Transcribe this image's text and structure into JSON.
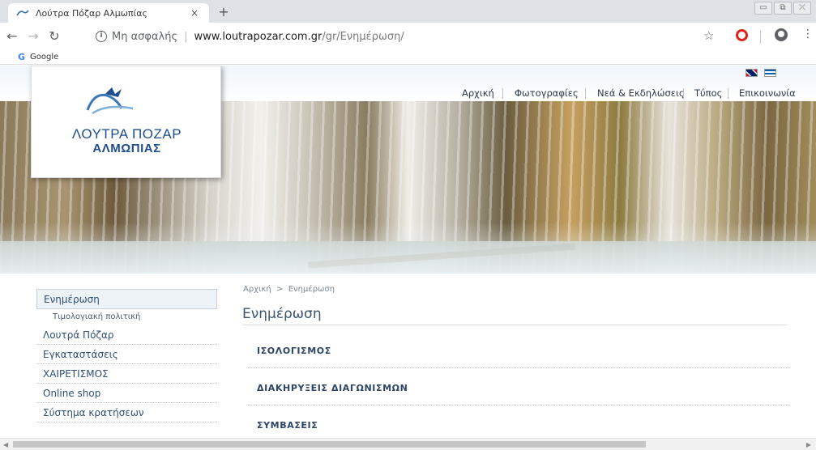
{
  "browser": {
    "tab_title": "Λούτρα Πόζαρ Αλμωπίας",
    "tab_close": "×",
    "new_tab": "+",
    "window_controls": [
      "▭",
      "⧉",
      "⤫"
    ],
    "not_secure": "Μη ασφαλής",
    "url_host": "www.loutrapozar.com.gr",
    "url_path": "/gr/Ενημέρωση/",
    "bookmark_google": "Google",
    "icons": [
      "back-arrow-icon",
      "forward-arrow-icon",
      "reload-icon",
      "info-icon",
      "star-icon",
      "opera-icon",
      "profile-icon",
      "menu-icon"
    ]
  },
  "site": {
    "logo_line1": "ΛΟΥΤΡΑ ΠΟΖΑΡ",
    "logo_line2": "ΑΛΜΩΠΙΑΣ",
    "brand_color": "#1f4e8a",
    "nav": [
      {
        "label": "Αρχική"
      },
      {
        "label": "Φωτογραφίες"
      },
      {
        "label": "Νεά & Εκδηλώσεις"
      },
      {
        "label": "Τύπος"
      },
      {
        "label": "Επικοινωνία"
      }
    ],
    "languages": [
      "uk-flag-icon",
      "gr-flag-icon"
    ]
  },
  "sidebar": {
    "items": [
      {
        "label": "Ενημέρωση",
        "active": true
      },
      {
        "label": "Τιμολογιακή πολιτική",
        "sub": true
      },
      {
        "label": "Λουτρά Πόζαρ"
      },
      {
        "label": "Εγκαταστάσεις"
      },
      {
        "label": "ΧΑΙΡΕΤΙΣΜΟΣ"
      },
      {
        "label": "Online shop"
      },
      {
        "label": "Σύστημα κρατήσεων"
      }
    ]
  },
  "main": {
    "breadcrumb_home": "Αρχική",
    "breadcrumb_sep": ">",
    "breadcrumb_current": "Ενημέρωση",
    "title": "Ενημέρωση",
    "entries": [
      {
        "label": "ΙΣΟΛΟΓΙΣΜΟΣ"
      },
      {
        "label": "ΔΙΑΚΗΡΥΞΕΙΣ ΔΙΑΓΩΝΙΣΜΩΝ"
      },
      {
        "label": "ΣΥΜΒΑΣΕΙΣ"
      }
    ]
  }
}
